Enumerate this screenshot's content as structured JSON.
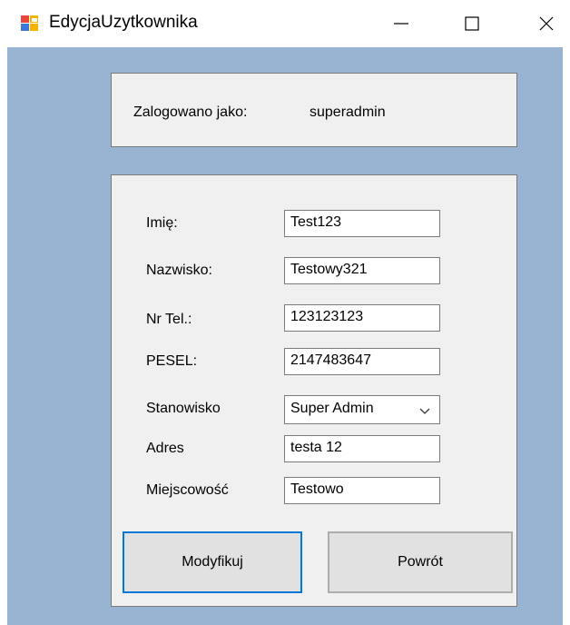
{
  "window": {
    "title": "EdycjaUzytkownika",
    "icon": "windows-forms-app-icon"
  },
  "login": {
    "label": "Zalogowano jako:",
    "user": "superadmin"
  },
  "form": {
    "fields": [
      {
        "label": "Imię:",
        "value": "Test123"
      },
      {
        "label": "Nazwisko:",
        "value": "Testowy321"
      },
      {
        "label": "Nr Tel.:",
        "value": "123123123"
      },
      {
        "label": "PESEL:",
        "value": "2147483647"
      },
      {
        "label": "Stanowisko",
        "value": "Super Admin"
      },
      {
        "label": "Adres",
        "value": "testa 12"
      },
      {
        "label": "Miejscowość",
        "value": "Testowo"
      }
    ]
  },
  "buttons": {
    "modify": "Modyfikuj",
    "back": "Powrót"
  },
  "colors": {
    "client_background": "#98b4d2",
    "panel_background": "#f0f0f0",
    "focus_border": "#0078d7"
  }
}
